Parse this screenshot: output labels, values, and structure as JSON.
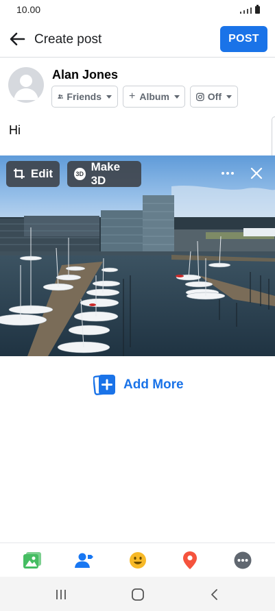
{
  "status_bar": {
    "time": "10.00"
  },
  "header": {
    "title": "Create post",
    "post_label": "POST",
    "back_icon": "arrow-left-icon"
  },
  "user": {
    "name": "Alan Jones",
    "avatar_icon": "default-avatar-icon"
  },
  "audience": {
    "friends_label": "Friends",
    "album_label": "Album",
    "instagram_label": "Off"
  },
  "post": {
    "text": "Hi"
  },
  "photo_toolbar": {
    "edit_label": "Edit",
    "make3d_label": "Make 3D",
    "make3d_badge": "3D"
  },
  "add_more": {
    "label": "Add More"
  },
  "bottom_bar": {
    "icons": [
      "photo-icon",
      "tag-people-icon",
      "feeling-icon",
      "location-icon",
      "more-options-icon"
    ]
  },
  "nav_bar": {
    "icons": [
      "recent-apps-icon",
      "home-icon",
      "back-icon"
    ]
  },
  "colors": {
    "accent": "#1a73e8",
    "photo_green": "#45bd62",
    "feeling_yellow": "#f7b928",
    "location_red": "#f5533d",
    "more_gray": "#606770"
  }
}
